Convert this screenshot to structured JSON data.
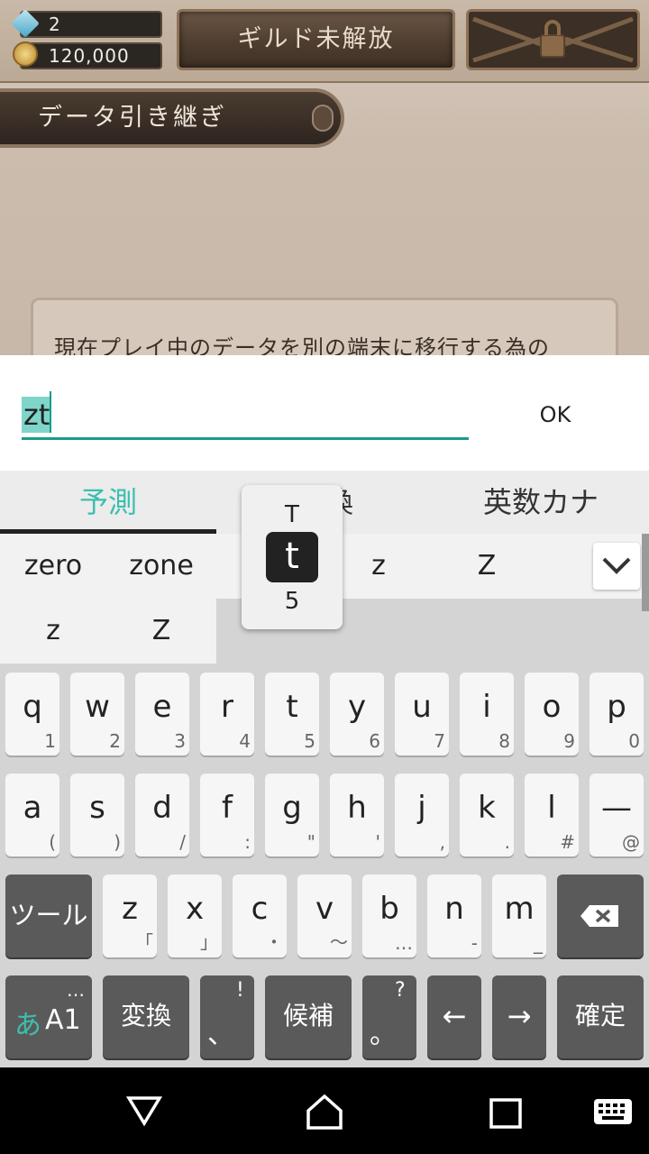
{
  "game": {
    "gems": "2",
    "coins": "120,000",
    "guild_button": "ギルド未解放",
    "section_title": "データ引き継ぎ",
    "panel_text": "現在プレイ中のデータを別の端末に移行する為の"
  },
  "dialog": {
    "input_value": "zt",
    "ok_label": "OK"
  },
  "keyboard": {
    "tabs": [
      "予測",
      "変換",
      "英数カナ"
    ],
    "candidates_row1": [
      "zero",
      "zone",
      "z",
      "Z"
    ],
    "candidates_row2": [
      "z",
      "Z"
    ],
    "popup": {
      "upper": "T",
      "main": "t",
      "digit": "5"
    },
    "row1": [
      {
        "k": "q",
        "s": "1"
      },
      {
        "k": "w",
        "s": "2"
      },
      {
        "k": "e",
        "s": "3"
      },
      {
        "k": "r",
        "s": "4"
      },
      {
        "k": "t",
        "s": "5"
      },
      {
        "k": "y",
        "s": "6"
      },
      {
        "k": "u",
        "s": "7"
      },
      {
        "k": "i",
        "s": "8"
      },
      {
        "k": "o",
        "s": "9"
      },
      {
        "k": "p",
        "s": "0"
      }
    ],
    "row2": [
      {
        "k": "a",
        "s": "("
      },
      {
        "k": "s",
        "s": ")"
      },
      {
        "k": "d",
        "s": "/"
      },
      {
        "k": "f",
        "s": ":"
      },
      {
        "k": "g",
        "s": "\""
      },
      {
        "k": "h",
        "s": "'"
      },
      {
        "k": "j",
        "s": ","
      },
      {
        "k": "k",
        "s": "."
      },
      {
        "k": "l",
        "s": "#"
      },
      {
        "k": "—",
        "s": "@"
      }
    ],
    "row3_tool": "ツール",
    "row3": [
      {
        "k": "z",
        "s": "「"
      },
      {
        "k": "x",
        "s": "」"
      },
      {
        "k": "c",
        "s": "・"
      },
      {
        "k": "v",
        "s": "〜"
      },
      {
        "k": "b",
        "s": "…"
      },
      {
        "k": "n",
        "s": "-"
      },
      {
        "k": "m",
        "s": "_"
      }
    ],
    "row4": {
      "mode_a": "あ",
      "mode_b": "A1",
      "mode_dots": "…",
      "convert": "変換",
      "comma": "、",
      "comma_sub": "!",
      "candidates": "候補",
      "period": "。",
      "period_sub": "?",
      "left": "←",
      "right": "→",
      "confirm": "確定"
    }
  },
  "colors": {
    "accent": "#1a9a8a",
    "tab_active": "#3cbfae"
  }
}
